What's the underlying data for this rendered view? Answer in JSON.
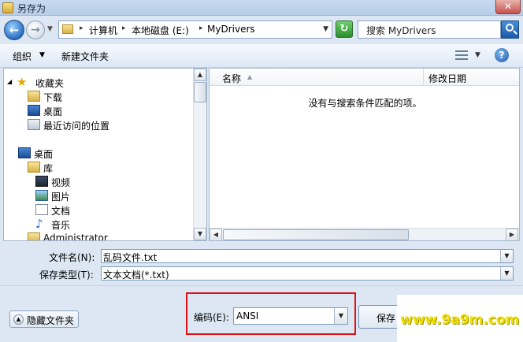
{
  "window": {
    "title": "另存为",
    "close_glyph": "✕"
  },
  "nav": {
    "back_glyph": "←",
    "forward_glyph": "→",
    "address_segments": [
      "计算机",
      "本地磁盘 (E:)",
      "MyDrivers"
    ],
    "search_placeholder": "搜索 MyDrivers"
  },
  "toolbar": {
    "organize_label": "组织",
    "new_folder_label": "新建文件夹"
  },
  "navpane": {
    "favorites": "收藏夹",
    "downloads": "下载",
    "desktop_fav": "桌面",
    "recent": "最近访问的位置",
    "desktop": "桌面",
    "libraries": "库",
    "videos": "视频",
    "pictures": "图片",
    "documents": "文档",
    "music": "音乐",
    "admin": "Administrator"
  },
  "filelist": {
    "col_name": "名称",
    "col_modified": "修改日期",
    "empty_message": "没有与搜索条件匹配的项。"
  },
  "form": {
    "filename_label": "文件名(N):",
    "filename_value": "乱码文件.txt",
    "filetype_label": "保存类型(T):",
    "filetype_value": "文本文档(*.txt)",
    "hide_folders_label": "隐藏文件夹",
    "encoding_label": "编码(E):",
    "encoding_value": "ANSI",
    "save_label": "保存"
  },
  "watermark": "www.9a9m.com",
  "colors": {
    "highlight_box": "#e01010",
    "watermark": "#f0e000"
  }
}
